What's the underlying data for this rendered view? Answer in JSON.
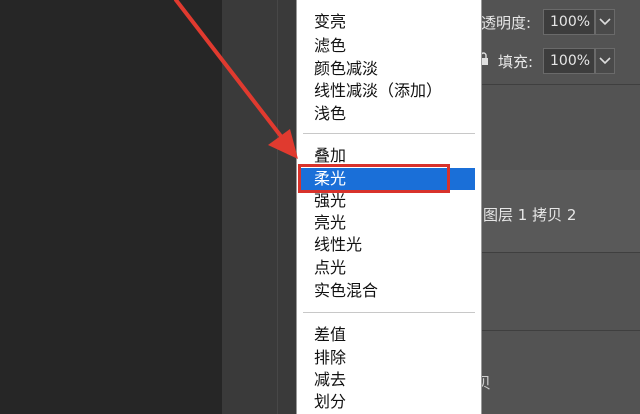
{
  "layers_panel": {
    "opacity_label": "不透明度:",
    "opacity_value": "100%",
    "fill_label": "填充:",
    "fill_value": "100%",
    "layer_name": "图层 1 拷贝 2",
    "partial_char": "贝"
  },
  "blend_menu": {
    "groups": [
      [
        "变亮",
        "滤色",
        "颜色减淡",
        "线性减淡（添加）",
        "浅色"
      ],
      [
        "叠加",
        "柔光",
        "强光",
        "亮光",
        "线性光",
        "点光",
        "实色混合"
      ],
      [
        "差值",
        "排除",
        "减去",
        "划分"
      ]
    ],
    "selected": "柔光"
  },
  "annotation": {
    "arrow_color": "#e03a2f",
    "highlight_color": "#d8322b"
  }
}
